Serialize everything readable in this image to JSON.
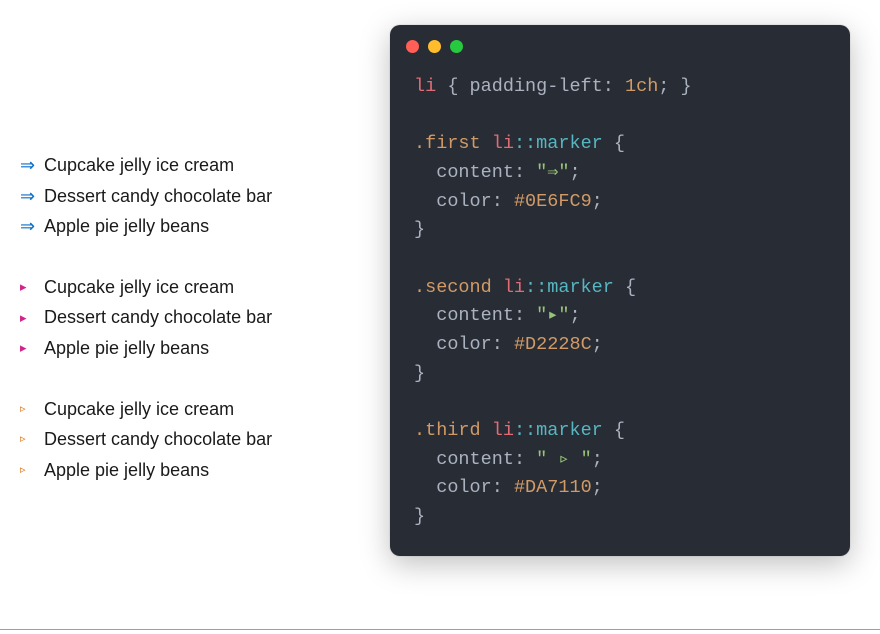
{
  "lists": [
    {
      "markerClass": "m1",
      "markerGlyph": "⇒",
      "markerColor": "#0E6FC9",
      "items": [
        "Cupcake jelly ice cream",
        "Dessert candy chocolate bar",
        "Apple pie jelly beans"
      ]
    },
    {
      "markerClass": "m2",
      "markerGlyph": "▸",
      "markerColor": "#D2228C",
      "items": [
        "Cupcake jelly ice cream",
        "Dessert candy chocolate bar",
        "Apple pie jelly beans"
      ]
    },
    {
      "markerClass": "m3",
      "markerGlyph": "▹",
      "markerColor": "#DA7110",
      "items": [
        "Cupcake jelly ice cream",
        "Dessert candy chocolate bar",
        "Apple pie jelly beans"
      ]
    }
  ],
  "code": {
    "rule1": {
      "selector_tag": "li",
      "brace_open": " { ",
      "prop": "padding-left",
      "colon": ": ",
      "val": "1ch",
      "semi_brace": "; }"
    },
    "rules": [
      {
        "cls": ".first",
        "content": "\"⇒\"",
        "color": "#0E6FC9"
      },
      {
        "cls": ".second",
        "content": "\"▸\"",
        "color": "#D2228C"
      },
      {
        "cls": ".third",
        "content": "\" ▹ \"",
        "color": "#DA7110"
      }
    ],
    "tokens": {
      "li": "li",
      "pseudo": "::marker",
      "brace_open": " {",
      "brace_close": "}",
      "indent": "  ",
      "content_prop": "content",
      "color_prop": "color",
      "colon_sp": ": ",
      "semi": ";"
    }
  }
}
